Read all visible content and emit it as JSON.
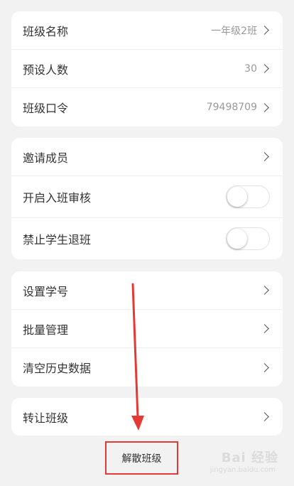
{
  "group1": [
    {
      "label": "班级名称",
      "value": "一年级2班"
    },
    {
      "label": "预设人数",
      "value": "30"
    },
    {
      "label": "班级口令",
      "value": "79498709"
    }
  ],
  "group2": {
    "invite_label": "邀请成员",
    "approval_label": "开启入班审核",
    "approval_on": false,
    "no_exit_label": "禁止学生退班",
    "no_exit_on": false
  },
  "group3": [
    {
      "label": "设置学号"
    },
    {
      "label": "批量管理"
    },
    {
      "label": "清空历史数据"
    }
  ],
  "group4": {
    "transfer_label": "转让班级"
  },
  "disband_label": "解散班级",
  "watermark": {
    "text": "Bai 经验",
    "sub": "jingyan.baidu.com"
  },
  "colors": {
    "highlight": "#e53935",
    "background": "#f2f2f2"
  }
}
